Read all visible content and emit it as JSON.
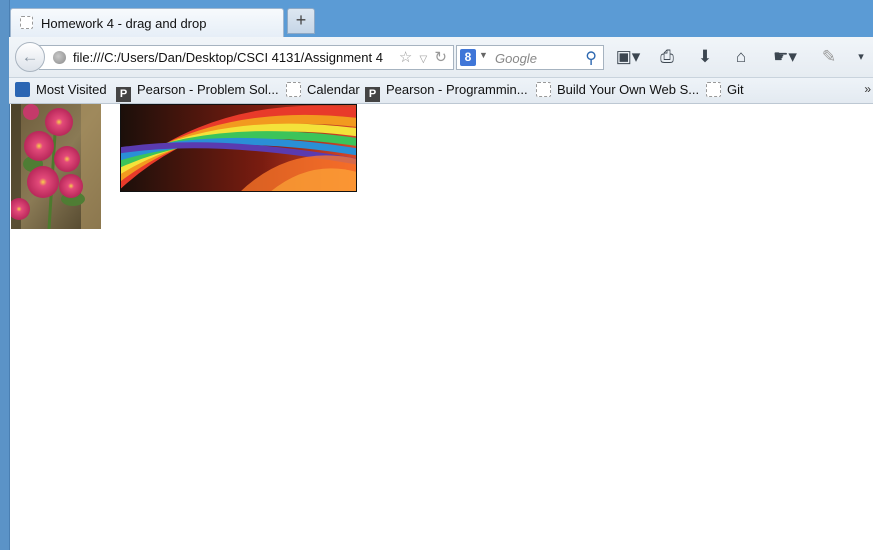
{
  "tab": {
    "title": "Homework 4 - drag and drop",
    "new_tab_label": "+"
  },
  "navbar": {
    "url": "file:///C:/Users/Dan/Desktop/CSCI 4131/Assignment 4",
    "search_engine_letter": "8",
    "search_placeholder": "Google"
  },
  "bookmarks": {
    "items": [
      {
        "label": "Most Visited",
        "icon": "most-visited-icon"
      },
      {
        "label": "Pearson - Problem Sol...",
        "icon": "pearson-icon"
      },
      {
        "label": "Calendar",
        "icon": "blank-page-icon"
      },
      {
        "label": "Pearson - Programmin...",
        "icon": "pearson-icon"
      },
      {
        "label": "Build Your Own Web S...",
        "icon": "blank-page-icon"
      },
      {
        "label": "Git",
        "icon": "blank-page-icon"
      }
    ],
    "pearson_letter": "P",
    "overflow": "»"
  },
  "content": {
    "images": [
      {
        "name": "pink-hollyhock-flowers"
      },
      {
        "name": "rainbow-light-streaks"
      }
    ]
  },
  "colors": {
    "tab_strip": "#5b9bd5",
    "window_frame": "#5b93c7",
    "toolbar": "#eaeff5"
  }
}
